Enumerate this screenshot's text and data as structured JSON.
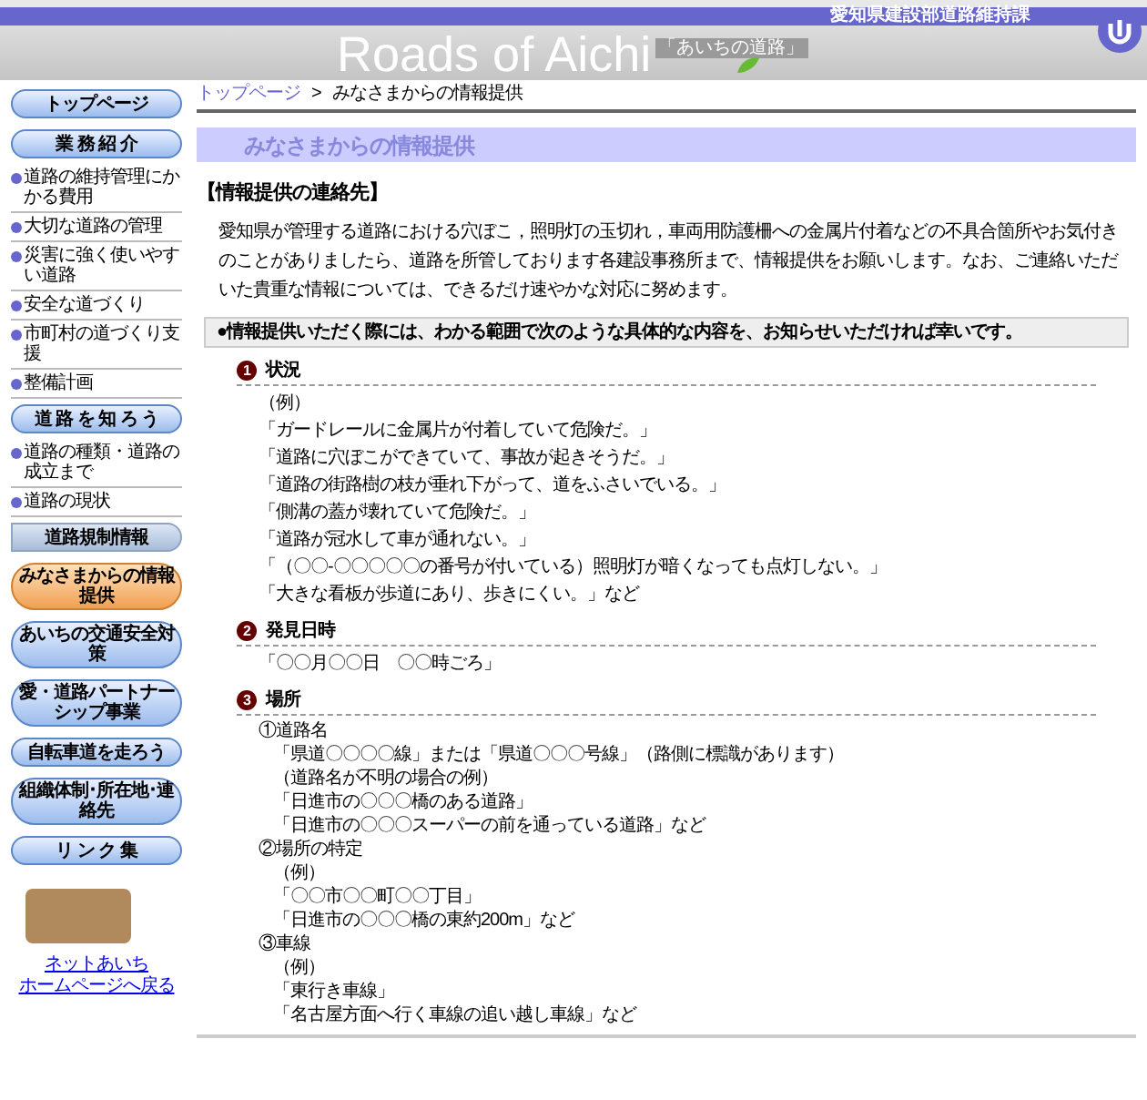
{
  "header": {
    "department": "愛知県建設部道路維持課",
    "site_title": "Roads of Aichi",
    "site_subtitle": "「あいちの道路」"
  },
  "sidebar": {
    "items": [
      {
        "kind": "pill",
        "label": "トップページ",
        "selected": false
      },
      {
        "kind": "pill",
        "label": "業 務 紹 介",
        "selected": false
      },
      {
        "kind": "bullet",
        "label": "道路の維持管理にかかる費用"
      },
      {
        "kind": "bullet",
        "label": "大切な道路の管理"
      },
      {
        "kind": "bullet",
        "label": "災害に強く使いやすい道路"
      },
      {
        "kind": "bullet",
        "label": "安全な道づくり"
      },
      {
        "kind": "bullet",
        "label": "市町村の道づくり支援"
      },
      {
        "kind": "bullet",
        "label": "整備計画"
      },
      {
        "kind": "pill",
        "label": "道 路 を 知 ろ う",
        "selected": false
      },
      {
        "kind": "bullet",
        "label": "道路の種類・道路の成立まで"
      },
      {
        "kind": "bullet",
        "label": "道路の現状"
      },
      {
        "kind": "section",
        "label": "道路規制情報"
      },
      {
        "kind": "pill",
        "label": "みなさまからの情報提供",
        "selected": true
      },
      {
        "kind": "pill",
        "label": "あいちの交通安全対策",
        "selected": false
      },
      {
        "kind": "pill",
        "label": "愛・道路パートナーシップ事業",
        "selected": false
      },
      {
        "kind": "pill",
        "label": "自転車道を走ろう",
        "selected": false
      },
      {
        "kind": "pill",
        "label": "組織体制･所在地･連絡先",
        "selected": false
      },
      {
        "kind": "pill",
        "label": "リ ン ク 集",
        "selected": false
      }
    ],
    "footer_links": [
      "ネットあいち",
      "ホームページへ戻る"
    ]
  },
  "breadcrumb": {
    "items": [
      {
        "label": "トップページ",
        "link": true
      },
      {
        "label": "みなさまからの情報提供",
        "link": false
      }
    ],
    "separator": ">"
  },
  "page_title": "みなさまからの情報提供",
  "section_heading": "【情報提供の連絡先】",
  "intro": "愛知県が管理する道路における穴ぼこ，照明灯の玉切れ，車両用防護柵への金属片付着などの不具合箇所やお気付きのことがありましたら、道路を所管しております各建設事務所まで、情報提供をお願いします。なお、ご連絡いただいた貴重な情報については、できるだけ速やかな対応に努めます。",
  "notice": "●情報提供いただく際には、わかる範囲で次のような具体的な内容を、お知らせいただければ幸いです。",
  "sections": [
    {
      "marker": "1",
      "title": "状況",
      "lines": [
        {
          "text": "（例）"
        },
        {
          "text": "「ガードレールに金属片が付着していて危険だ。」"
        },
        {
          "text": "「道路に穴ぼこができていて、事故が起きそうだ。」"
        },
        {
          "text": "「道路の街路樹の枝が垂れ下がって、道をふさいでいる。」"
        },
        {
          "text": "「側溝の蓋が壊れていて危険だ。」"
        },
        {
          "text": "「道路が冠水して車が通れない。」"
        },
        {
          "text": "「（〇〇-〇〇〇〇〇の番号が付いている）照明灯が暗くなっても点灯しない。」"
        },
        {
          "text": "「大きな看板が歩道にあり、歩きにくい。」など"
        }
      ]
    },
    {
      "marker": "2",
      "title": "発見日時",
      "lines": [
        {
          "text": "「〇〇月〇〇日　〇〇時ごろ」"
        }
      ]
    },
    {
      "marker": "3",
      "title": "場所",
      "lines": [
        {
          "text": "①道路名",
          "children": [
            {
              "text": "「県道〇〇〇〇線」または「県道〇〇〇号線」（路側に標識があります）"
            },
            {
              "text": "（道路名が不明の場合の例）"
            },
            {
              "text": "「日進市の〇〇〇橋のある道路」"
            },
            {
              "text": "「日進市の〇〇〇スーパーの前を通っている道路」など"
            }
          ]
        },
        {
          "text": "②場所の特定",
          "children": [
            {
              "text": "（例）"
            },
            {
              "text": "「〇〇市〇〇町〇〇丁目」"
            },
            {
              "text": "「日進市の〇〇〇橋の東約200m」など"
            }
          ]
        },
        {
          "text": "③車線",
          "children": [
            {
              "text": "（例）"
            },
            {
              "text": "「東行き車線」"
            },
            {
              "text": "「名古屋方面へ行く車線の追い越し車線」など"
            }
          ]
        }
      ]
    }
  ]
}
